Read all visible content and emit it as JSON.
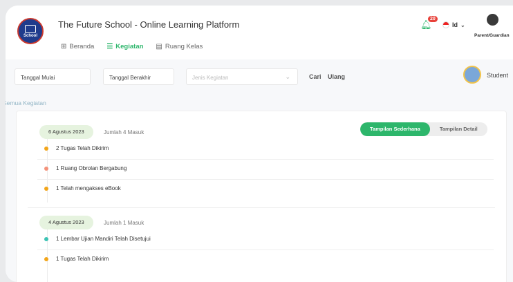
{
  "header": {
    "logo_text": "School",
    "title": "The Future School - Online Learning Platform",
    "nav": [
      {
        "label": "Beranda",
        "icon": "grid-icon"
      },
      {
        "label": "Kegiatan",
        "icon": "list-icon"
      },
      {
        "label": "Ruang Kelas",
        "icon": "book-icon"
      }
    ],
    "notification_count": "20",
    "language": "Id",
    "parent_label": "Parent/Guardian"
  },
  "filters": {
    "start_date": "Tanggal Mulai",
    "end_date": "Tanggal Berakhir",
    "activity_type_placeholder": "Jenis Kegiatan",
    "search": "Cari",
    "reset": "Ulang",
    "student_label": "Student"
  },
  "all_activities_label": "Semua Kegiatan",
  "view_toggle": {
    "simple": "Tampilan Sederhana",
    "detail": "Tampilan Detail"
  },
  "groups": [
    {
      "date": "6 Agustus 2023",
      "count": "Jumlah 4 Masuk",
      "items": [
        {
          "label": "2 Tugas Telah Dikirim",
          "color": "#f2a51a"
        },
        {
          "label": "1 Ruang Obrolan Bergabung",
          "color": "#f4927a"
        },
        {
          "label": "1 Telah mengakses eBook",
          "color": "#f2a51a"
        }
      ]
    },
    {
      "date": "4 Agustus 2023",
      "count": "Jumlah 1 Masuk",
      "items": [
        {
          "label": "1 Lembar Ujian Mandiri Telah Disetujui",
          "color": "#3cc3b4"
        },
        {
          "label": "1 Tugas Telah Dikirim",
          "color": "#f2a51a"
        }
      ]
    }
  ],
  "colors": {
    "accent": "#2db66b",
    "badge": "#e8413a"
  }
}
